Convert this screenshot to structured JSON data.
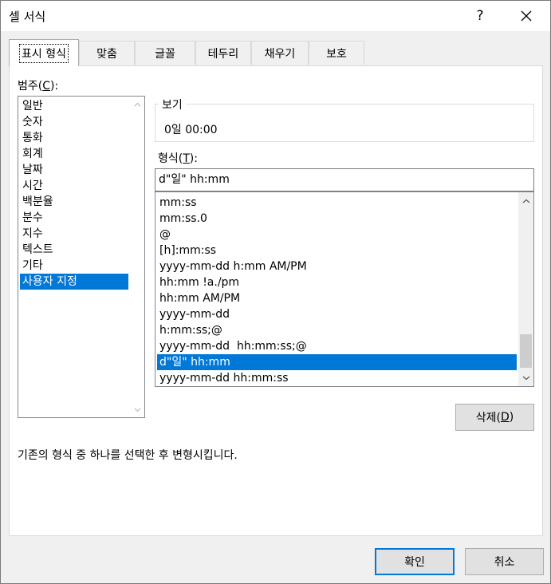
{
  "window": {
    "title": "셀 서식",
    "help": "?",
    "close_icon": "close-icon"
  },
  "tabs": [
    {
      "label": "표시 형식",
      "active": true
    },
    {
      "label": "맞춤",
      "active": false
    },
    {
      "label": "글꼴",
      "active": false
    },
    {
      "label": "테두리",
      "active": false
    },
    {
      "label": "채우기",
      "active": false
    },
    {
      "label": "보호",
      "active": false
    }
  ],
  "category": {
    "label_prefix": "범주(",
    "label_key": "C",
    "label_suffix": "):",
    "items": [
      "일반",
      "숫자",
      "통화",
      "회계",
      "날짜",
      "시간",
      "백분율",
      "분수",
      "지수",
      "텍스트",
      "기타",
      "사용자 지정"
    ],
    "selected": "사용자 지정"
  },
  "sample": {
    "label": "보기",
    "value": "0일 00:00"
  },
  "format": {
    "label_prefix": "형식(",
    "label_key": "T",
    "label_suffix": "):",
    "input_value": "d\"일\" hh:mm",
    "items": [
      "mm:ss",
      "mm:ss.0",
      "@",
      "[h]:mm:ss",
      "yyyy-mm-dd h:mm AM/PM",
      "hh:mm !a./pm",
      "hh:mm AM/PM",
      "yyyy-mm-dd",
      "h:mm:ss;@",
      "yyyy-mm-dd  hh:mm:ss;@",
      "d\"일\" hh:mm",
      "yyyy-mm-dd hh:mm:ss"
    ],
    "selected": "d\"일\" hh:mm"
  },
  "delete_button": {
    "label_prefix": "삭제(",
    "label_key": "D",
    "label_suffix": ")"
  },
  "description": "기존의 형식 중 하나를 선택한 후 변형시킵니다.",
  "footer": {
    "ok": "확인",
    "cancel": "취소"
  }
}
